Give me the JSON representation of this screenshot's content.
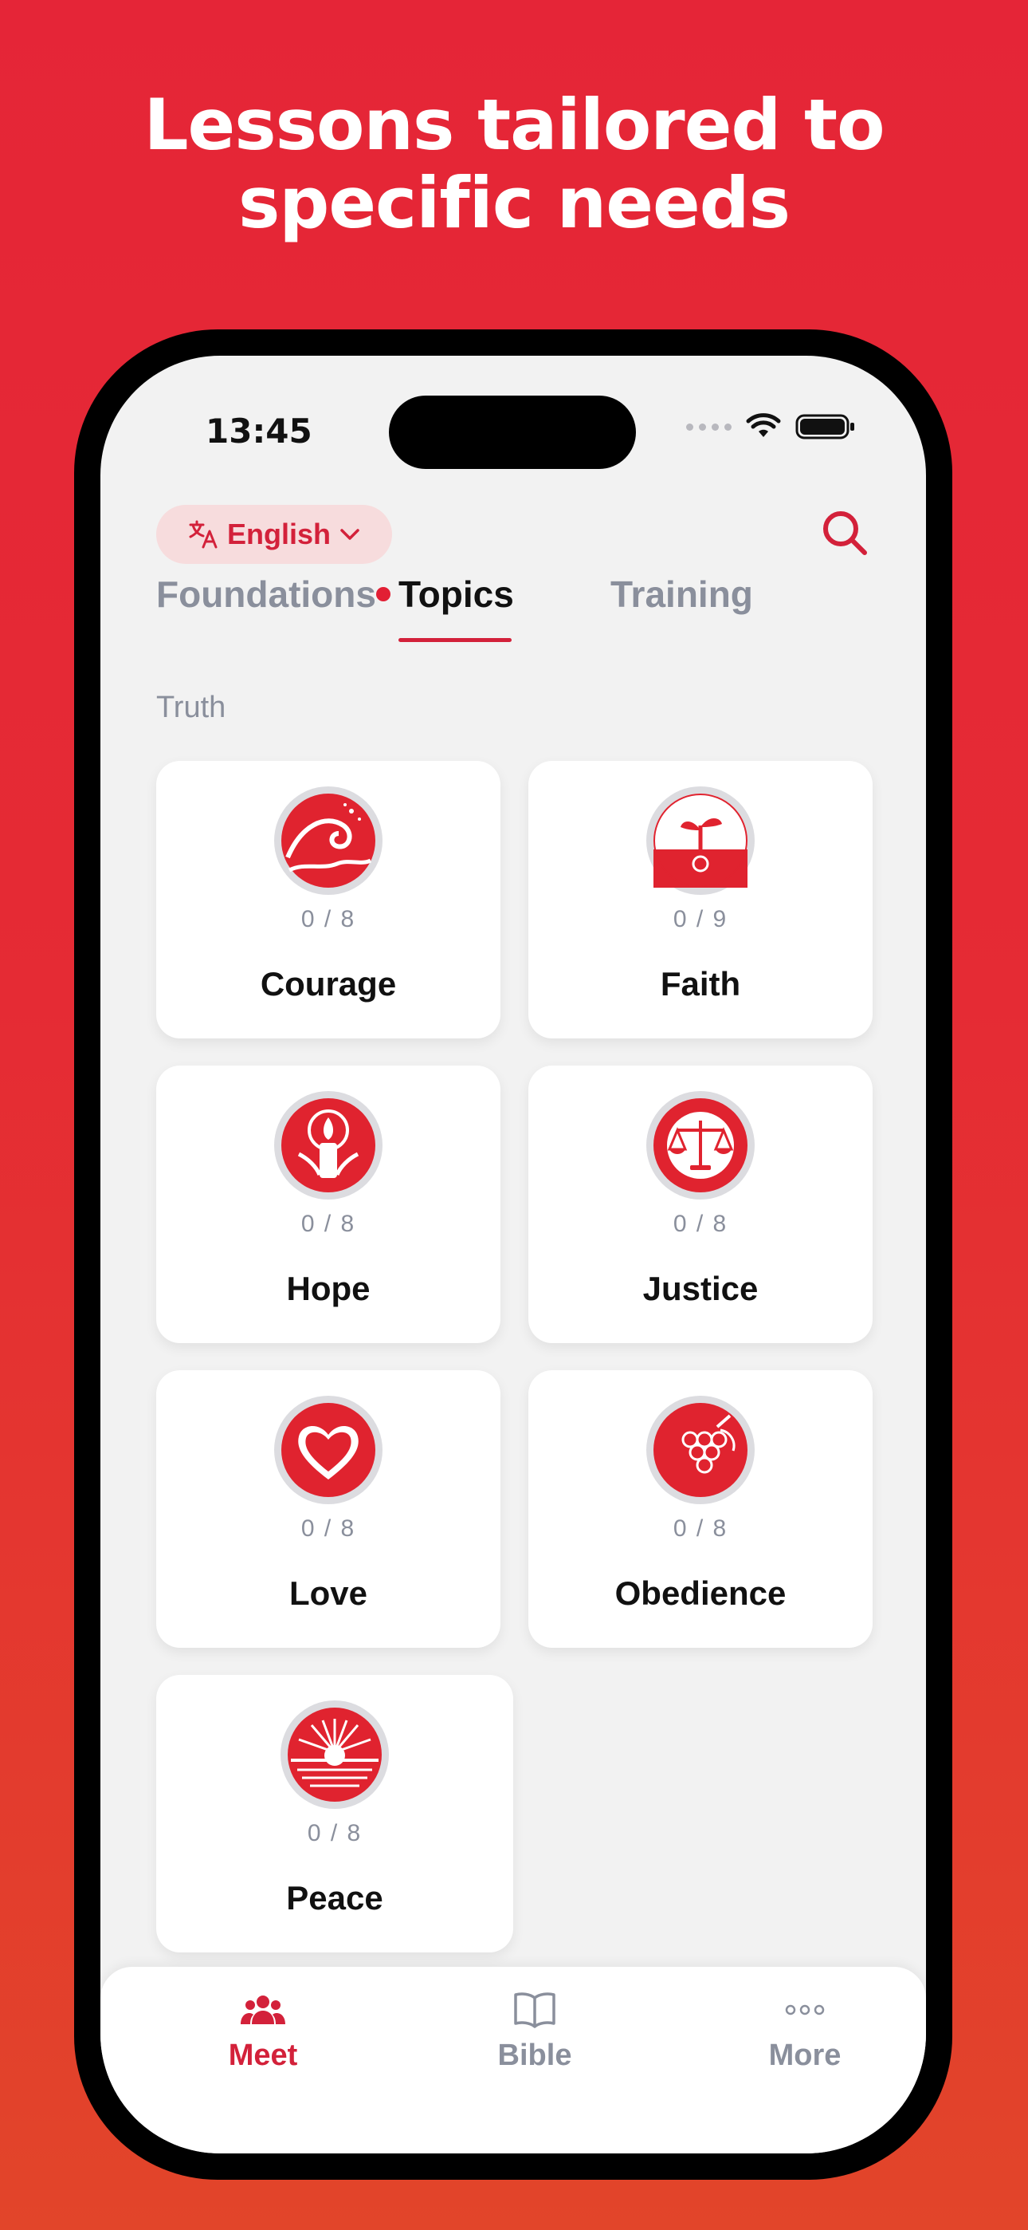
{
  "headline": {
    "line1": "Lessons tailored to",
    "line2": "specific needs"
  },
  "status_bar": {
    "time": "13:45"
  },
  "header": {
    "language_label": "English"
  },
  "tabs": [
    {
      "label": "Foundations",
      "active": false,
      "notification": true
    },
    {
      "label": "Topics",
      "active": true
    },
    {
      "label": "Training",
      "active": false
    }
  ],
  "section": {
    "label": "Truth"
  },
  "topics": [
    {
      "name": "Courage",
      "progress": "0 / 8",
      "icon": "wave-icon"
    },
    {
      "name": "Faith",
      "progress": "0 / 9",
      "icon": "sprout-icon"
    },
    {
      "name": "Hope",
      "progress": "0 / 8",
      "icon": "candle-icon"
    },
    {
      "name": "Justice",
      "progress": "0 / 8",
      "icon": "scales-icon"
    },
    {
      "name": "Love",
      "progress": "0 / 8",
      "icon": "heart-icon"
    },
    {
      "name": "Obedience",
      "progress": "0 / 8",
      "icon": "grapes-icon"
    },
    {
      "name": "Peace",
      "progress": "0 / 8",
      "icon": "sunrise-icon"
    }
  ],
  "tab_bar": [
    {
      "label": "Meet",
      "icon": "people-icon",
      "active": true
    },
    {
      "label": "Bible",
      "icon": "book-icon",
      "active": false
    },
    {
      "label": "More",
      "icon": "more-dots-icon",
      "active": false
    }
  ],
  "colors": {
    "accent": "#D3213A",
    "muted": "#8A8F9C",
    "background_top": "#E52537",
    "background_bottom": "#E2452A"
  }
}
